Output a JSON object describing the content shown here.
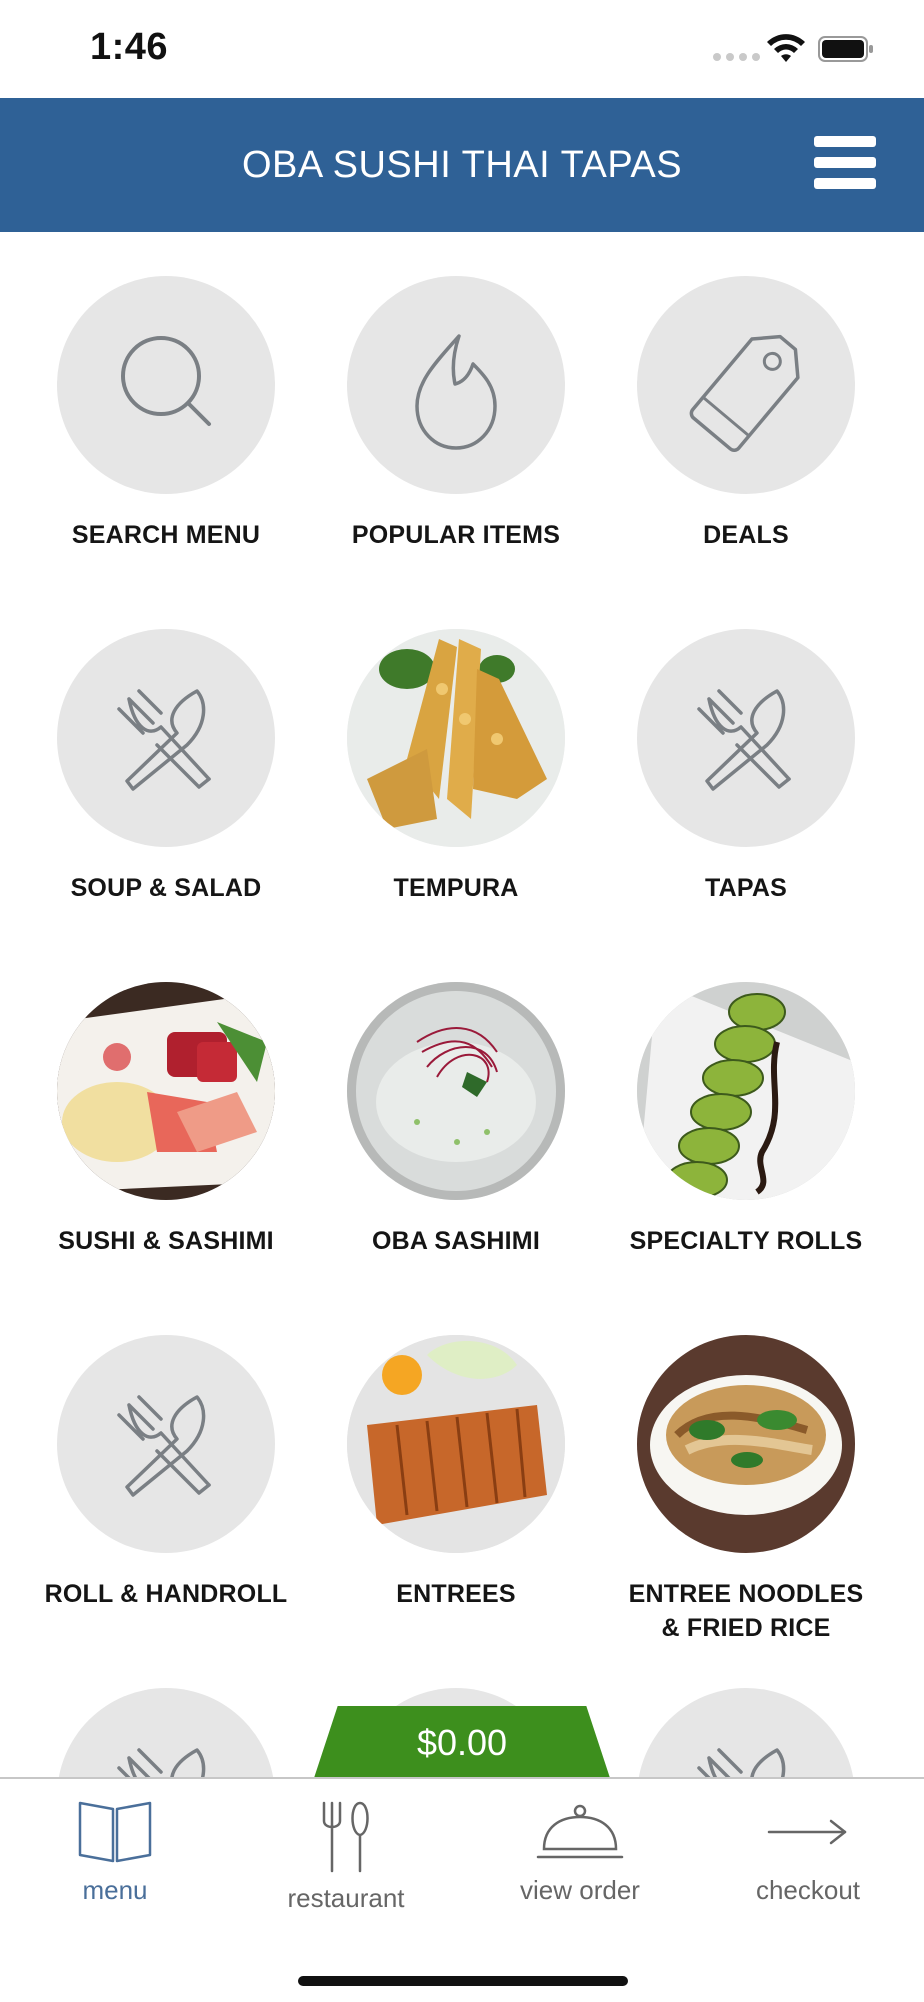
{
  "status": {
    "time": "1:46"
  },
  "header": {
    "title": "OBA SUSHI THAI TAPAS"
  },
  "colors": {
    "header_bg": "#2f6196",
    "tile_bg": "#e6e6e6",
    "cart_bg": "#3d8f1d",
    "active_tab": "#4a6f9a"
  },
  "tiles": [
    {
      "label": "SEARCH MENU",
      "icon": "search-icon"
    },
    {
      "label": "POPULAR ITEMS",
      "icon": "flame-icon"
    },
    {
      "label": "DEALS",
      "icon": "tag-icon"
    },
    {
      "label": "SOUP & SALAD",
      "icon": "fork-knife-icon"
    },
    {
      "label": "TEMPURA",
      "icon": "tempura-photo"
    },
    {
      "label": "TAPAS",
      "icon": "fork-knife-icon"
    },
    {
      "label": "SUSHI & SASHIMI",
      "icon": "sushi-sashimi-photo"
    },
    {
      "label": "OBA SASHIMI",
      "icon": "oba-sashimi-photo"
    },
    {
      "label": "SPECIALTY ROLLS",
      "icon": "specialty-rolls-photo"
    },
    {
      "label": "ROLL & HANDROLL",
      "icon": "fork-knife-icon"
    },
    {
      "label": "ENTREES",
      "icon": "entrees-photo"
    },
    {
      "label": "ENTREE NOODLES\n& FRIED RICE",
      "icon": "noodles-photo"
    },
    {
      "label": "",
      "icon": "fork-knife-icon"
    },
    {
      "label": "",
      "icon": "fork-knife-icon"
    },
    {
      "label": "",
      "icon": "fork-knife-icon"
    }
  ],
  "cart": {
    "amount": "$0.00"
  },
  "tabs": [
    {
      "label": "menu",
      "icon": "book-icon"
    },
    {
      "label": "restaurant",
      "icon": "utensils-icon"
    },
    {
      "label": "view order",
      "icon": "cloche-icon"
    },
    {
      "label": "checkout",
      "icon": "arrow-right-icon"
    }
  ]
}
